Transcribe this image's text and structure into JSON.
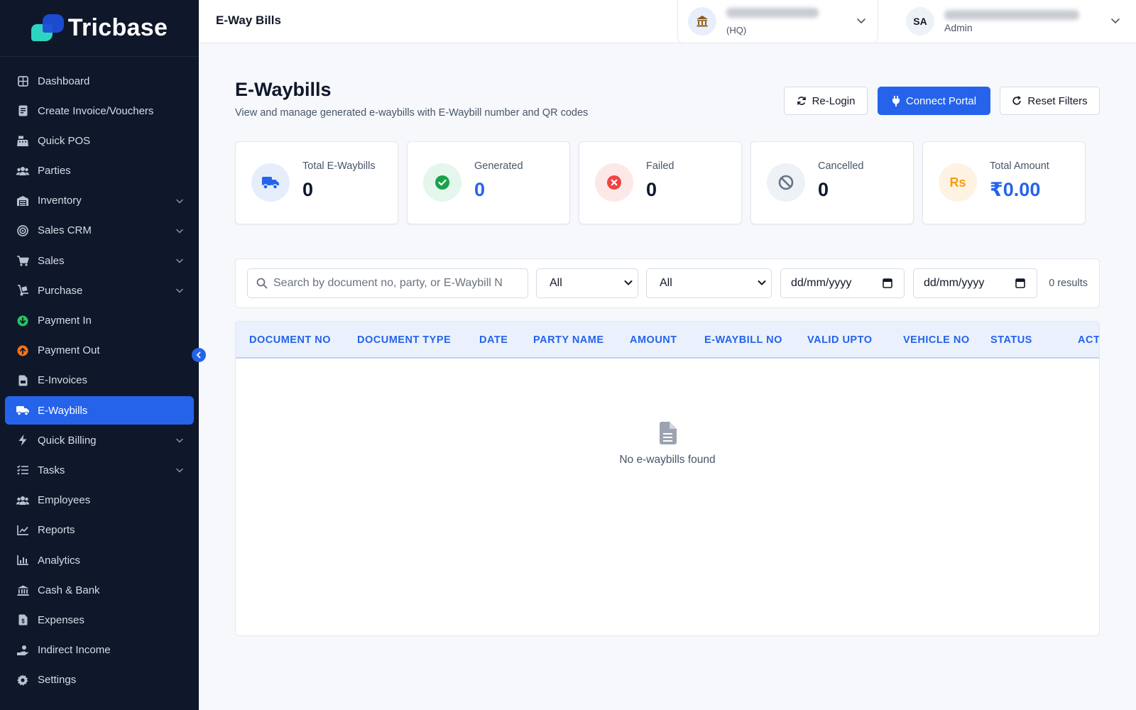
{
  "brand": {
    "name": "Tricbase"
  },
  "sidebar": {
    "items": [
      {
        "label": "Dashboard",
        "icon": "grid-icon",
        "expandable": false
      },
      {
        "label": "Create Invoice/Vouchers",
        "icon": "invoice-icon",
        "expandable": false
      },
      {
        "label": "Quick POS",
        "icon": "cash-register-icon",
        "expandable": false
      },
      {
        "label": "Parties",
        "icon": "users-icon",
        "expandable": false
      },
      {
        "label": "Inventory",
        "icon": "warehouse-icon",
        "expandable": true
      },
      {
        "label": "Sales CRM",
        "icon": "target-icon",
        "expandable": true
      },
      {
        "label": "Sales",
        "icon": "cart-icon",
        "expandable": true
      },
      {
        "label": "Purchase",
        "icon": "dolly-icon",
        "expandable": true
      },
      {
        "label": "Payment In",
        "icon": "arrow-down-circle-icon",
        "expandable": false
      },
      {
        "label": "Payment Out",
        "icon": "arrow-up-circle-icon",
        "expandable": false
      },
      {
        "label": "E-Invoices",
        "icon": "file-invoice-icon",
        "expandable": false
      },
      {
        "label": "E-Waybills",
        "icon": "truck-icon",
        "expandable": false,
        "active": true
      },
      {
        "label": "Quick Billing",
        "icon": "bolt-icon",
        "expandable": true
      },
      {
        "label": "Tasks",
        "icon": "list-check-icon",
        "expandable": true
      },
      {
        "label": "Employees",
        "icon": "users-icon",
        "expandable": false
      },
      {
        "label": "Reports",
        "icon": "line-chart-icon",
        "expandable": false
      },
      {
        "label": "Analytics",
        "icon": "bar-chart-icon",
        "expandable": false
      },
      {
        "label": "Cash & Bank",
        "icon": "bank-icon",
        "expandable": false
      },
      {
        "label": "Expenses",
        "icon": "receipt-icon",
        "expandable": false
      },
      {
        "label": "Indirect Income",
        "icon": "hand-coin-icon",
        "expandable": false
      },
      {
        "label": "Settings",
        "icon": "gear-icon",
        "expandable": false
      }
    ]
  },
  "header": {
    "title": "E-Way Bills",
    "branch": {
      "sub": "(HQ)"
    },
    "user": {
      "initials": "SA",
      "role": "Admin"
    }
  },
  "page": {
    "title": "E-Waybills",
    "subtitle": "View and manage generated e-waybills with E-Waybill number and QR codes",
    "actions": {
      "relogin": "Re-Login",
      "connect": "Connect Portal",
      "reset": "Reset Filters"
    }
  },
  "stats": [
    {
      "label": "Total E-Waybills",
      "value": "0",
      "icon": "truck-icon",
      "bg": "#e6eefc",
      "fg": "#2563eb",
      "valueColor": "#0f172a"
    },
    {
      "label": "Generated",
      "value": "0",
      "icon": "check-circle-icon",
      "bg": "#e5f6ec",
      "fg": "#16a34a",
      "valueColor": "#2563eb"
    },
    {
      "label": "Failed",
      "value": "0",
      "icon": "x-circle-icon",
      "bg": "#fde8e8",
      "fg": "#ef4444",
      "valueColor": "#0f172a"
    },
    {
      "label": "Cancelled",
      "value": "0",
      "icon": "ban-icon",
      "bg": "#eef1f5",
      "fg": "#64748b",
      "valueColor": "#0f172a"
    },
    {
      "label": "Total Amount",
      "value": "₹0.00",
      "icon": "rupee-icon",
      "bg": "#fef3e2",
      "fg": "#f59e0b",
      "valueColor": "#2563eb"
    }
  ],
  "filters": {
    "search_placeholder": "Search by document no, party, or E-Waybill N",
    "type_value": "All",
    "status_value": "All",
    "from_date": "dd/mm/yyyy",
    "to_date": "dd/mm/yyyy",
    "results": "0 results"
  },
  "table": {
    "columns": [
      "DOCUMENT NO",
      "DOCUMENT TYPE",
      "DATE",
      "PARTY NAME",
      "AMOUNT",
      "E-WAYBILL NO",
      "VALID UPTO",
      "VEHICLE NO",
      "STATUS",
      "ACT"
    ],
    "rows": [],
    "empty_text": "No e-waybills found"
  },
  "colors": {
    "accent": "#2563eb",
    "sidebar": "#0f172a"
  }
}
